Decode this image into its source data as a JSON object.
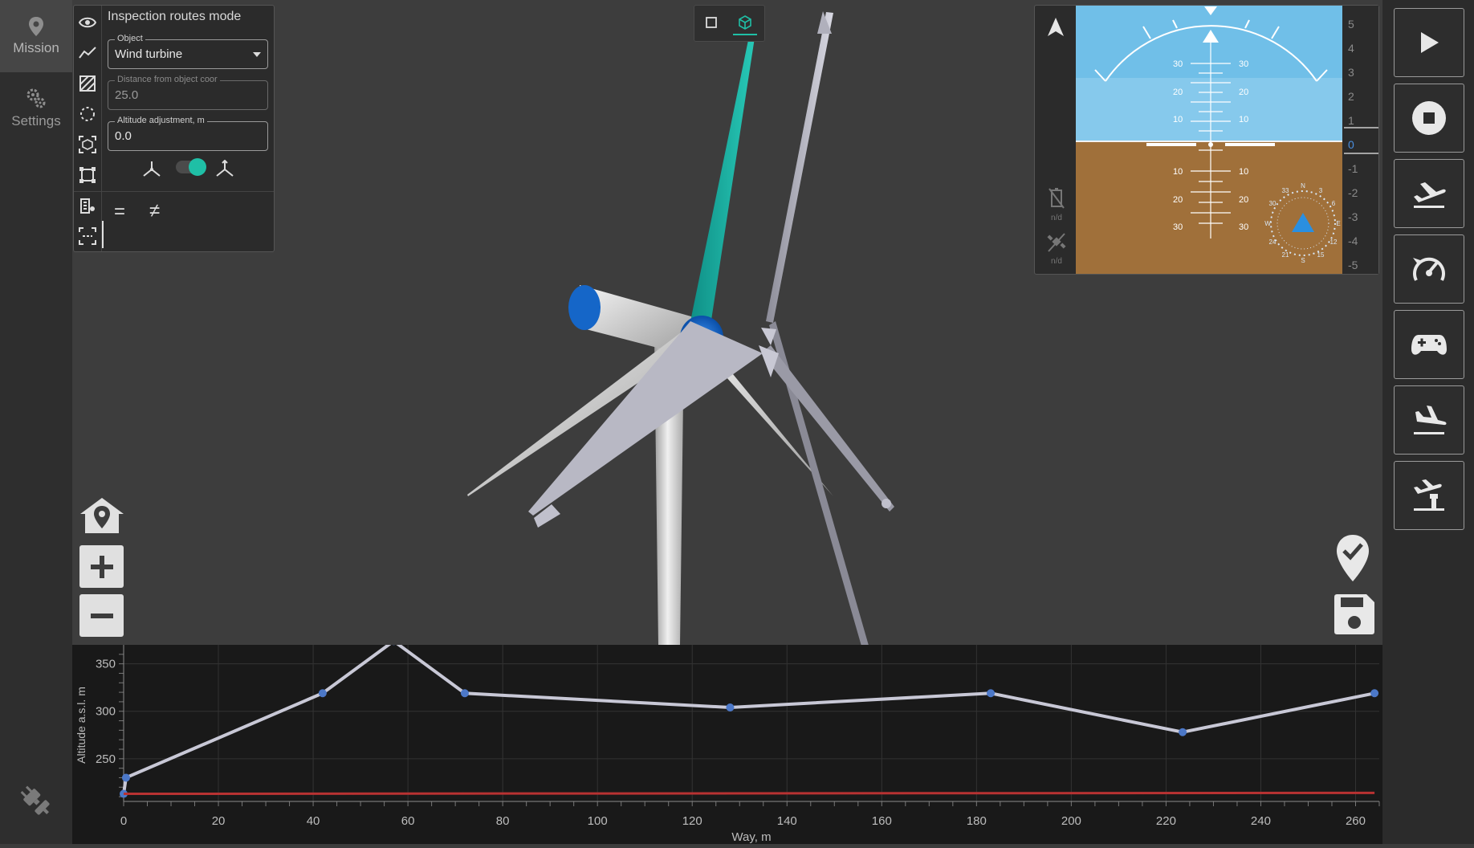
{
  "nav": {
    "items": [
      {
        "label": "Mission",
        "icon": "map-pin-icon",
        "active": true
      },
      {
        "label": "Settings",
        "icon": "gears-icon",
        "active": false
      }
    ],
    "bottom_icon": "plug-disconnected-icon"
  },
  "panel": {
    "title": "Inspection routes mode",
    "tools": [
      "eye-icon",
      "polyline-icon",
      "hatch-area-icon",
      "circle-route-icon",
      "object-scan-icon",
      "frame-route-icon",
      "building-pin-icon",
      "scan-frame-icon"
    ],
    "object_field": {
      "label": "Object",
      "value": "Wind turbine"
    },
    "distance_field": {
      "label": "Distance from object coor",
      "value": "25.0"
    },
    "altitude_field": {
      "label": "Altitude adjustment, m",
      "value": "0.0"
    },
    "toggle_on": true,
    "equal_symbol": "=",
    "not_equal_symbol": "≠"
  },
  "view_switch": {
    "options": [
      "2d-square-icon",
      "3d-cube-icon"
    ],
    "active": "3d-cube-icon"
  },
  "attitude": {
    "pitch_labels": [
      "30",
      "20",
      "10",
      "10",
      "20",
      "30"
    ],
    "scale_labels": [
      "5",
      "4",
      "3",
      "2",
      "1",
      "0",
      "-1",
      "-2",
      "-3",
      "-4",
      "-5"
    ],
    "current_value": "0",
    "na_labels": [
      "n/d",
      "n/d"
    ],
    "compass_labels": [
      "N",
      "3",
      "6",
      "E",
      "12",
      "15",
      "S",
      "21",
      "24",
      "W",
      "30",
      "33"
    ]
  },
  "right_buttons": [
    "play-icon",
    "stop-icon",
    "takeoff-icon",
    "speedometer-icon",
    "gamepad-icon",
    "landing-icon",
    "return-tower-icon"
  ],
  "map_controls": [
    "home-pin-icon",
    "zoom-in-icon",
    "zoom-out-icon"
  ],
  "map_actions": [
    "check-pin-icon",
    "save-icon"
  ],
  "chart_data": {
    "type": "line",
    "xlabel": "Way, m",
    "ylabel": "Altitude a.s.l. m",
    "xlim": [
      0,
      265
    ],
    "ylim": [
      205,
      370
    ],
    "xticks": [
      "0",
      "20",
      "40",
      "60",
      "80",
      "100",
      "120",
      "140",
      "160",
      "180",
      "200",
      "220",
      "240",
      "260"
    ],
    "yticks": [
      "250",
      "300",
      "350"
    ],
    "grid": true,
    "series": [
      {
        "name": "",
        "color": "#c8c8d6",
        "x": [
          0,
          0.5,
          42,
          57,
          72,
          128,
          183,
          223.5,
          264
        ],
        "y": [
          213,
          230,
          319,
          374,
          319,
          304,
          319,
          278,
          319
        ]
      },
      {
        "name": "",
        "color": "#b83232",
        "x": [
          0,
          264
        ],
        "y": [
          213,
          214
        ]
      }
    ]
  }
}
